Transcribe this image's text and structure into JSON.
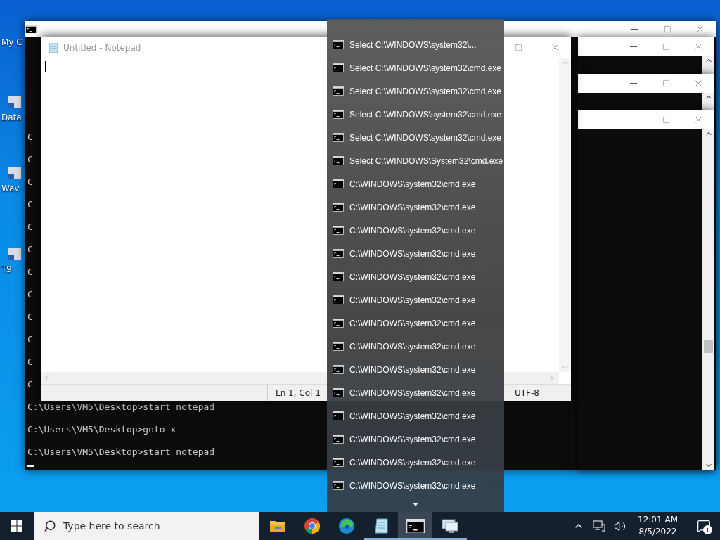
{
  "desktop_icons": [
    {
      "label": "My C"
    },
    {
      "label": "Data"
    },
    {
      "label": "Wav"
    },
    {
      "label": "T9"
    }
  ],
  "console": {
    "lines": [
      "C",
      "C",
      "C",
      "C",
      "C",
      "C",
      "C",
      "C",
      "C",
      "C",
      "C",
      "C",
      "C:\\Users\\VM5\\Desktop>start notepad",
      "C:\\Users\\VM5\\Desktop>goto x",
      "C:\\Users\\VM5\\Desktop>start notepad"
    ]
  },
  "notepad": {
    "title": "Untitled - Notepad",
    "status_position": "Ln 1, Col 1",
    "encoding": "UTF-8"
  },
  "jump_list": {
    "items": [
      "Select C:\\WINDOWS\\system32\\...",
      "Select C:\\WINDOWS\\system32\\cmd.exe",
      "Select C:\\WINDOWS\\system32\\cmd.exe",
      "Select C:\\WINDOWS\\system32\\cmd.exe",
      "Select C:\\WINDOWS\\system32\\cmd.exe",
      "Select C:\\WINDOWS\\System32\\cmd.exe",
      "C:\\WINDOWS\\system32\\cmd.exe",
      "C:\\WINDOWS\\system32\\cmd.exe",
      "C:\\WINDOWS\\system32\\cmd.exe",
      "C:\\WINDOWS\\system32\\cmd.exe",
      "C:\\WINDOWS\\system32\\cmd.exe",
      "C:\\WINDOWS\\system32\\cmd.exe",
      "C:\\WINDOWS\\system32\\cmd.exe",
      "C:\\WINDOWS\\system32\\cmd.exe",
      "C:\\WINDOWS\\system32\\cmd.exe",
      "C:\\WINDOWS\\system32\\cmd.exe",
      "C:\\WINDOWS\\system32\\cmd.exe",
      "C:\\WINDOWS\\system32\\cmd.exe",
      "C:\\WINDOWS\\system32\\cmd.exe",
      "C:\\WINDOWS\\system32\\cmd.exe"
    ]
  },
  "taskbar": {
    "search_placeholder": "Type here to search",
    "apps": [
      {
        "kind": "explorer",
        "running": false,
        "selected": false
      },
      {
        "kind": "chrome",
        "running": false,
        "selected": false
      },
      {
        "kind": "edge",
        "running": false,
        "selected": false
      },
      {
        "kind": "notepad",
        "running": true,
        "selected": false
      },
      {
        "kind": "console",
        "running": true,
        "selected": true
      },
      {
        "kind": "remote",
        "running": true,
        "selected": false
      }
    ],
    "tray": {
      "time": "12:01 AM",
      "date": "8/5/2022",
      "notifications": "1"
    }
  }
}
